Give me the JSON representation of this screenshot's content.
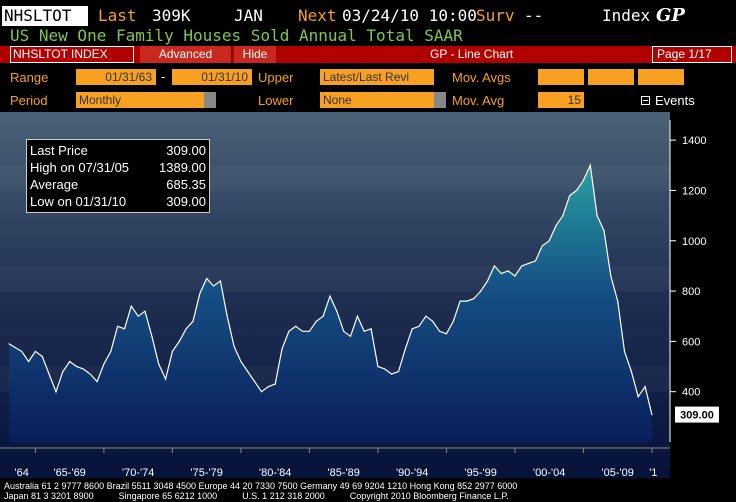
{
  "header": {
    "ticker": "NHSLTOT",
    "last_label": "Last",
    "last_value": "309K",
    "period": "JAN",
    "next_label": "Next",
    "next_value": "03/24/10 10:00",
    "surv_label": "Surv",
    "surv_value": "--",
    "index_label": "Index",
    "gp_label": "GP",
    "title": "US New One Family Houses Sold Annual Total SAAR"
  },
  "toolbar": {
    "security": "NHSLTOT INDEX",
    "advanced": "Advanced",
    "hide": "Hide",
    "chart_type": "GP - Line Chart",
    "page": "Page 1/17"
  },
  "controls": {
    "range_label": "Range",
    "range_start": "01/31/63",
    "range_dash": "-",
    "range_end": "01/31/10",
    "upper_label": "Upper",
    "upper_value": "Latest/Last Revi",
    "mov_avgs_label": "Mov. Avgs",
    "period_label": "Period",
    "period_value": "Monthly",
    "lower_label": "Lower",
    "lower_value": "None",
    "mov_avg_label": "Mov. Avg",
    "mov_avg_value": "15",
    "events_label": "Events"
  },
  "stats": {
    "last_price_label": "Last Price",
    "last_price_value": "309.00",
    "high_label": "High on 07/31/05",
    "high_value": "1389.00",
    "average_label": "Average",
    "average_value": "685.35",
    "low_label": "Low on 01/31/10",
    "low_value": "309.00"
  },
  "footer": {
    "line1": "Australia 61 2 9777 8600 Brazil 5511 3048 4500 Europe 44 20 7330 7500 Germany 49 69 9204 1210 Hong Kong 852 2977 6000",
    "line2": "Japan 81 3 3201 8900          Singapore 65 6212 1000          U.S. 1 212 318 2000          Copyright 2010 Bloomberg Finance L.P."
  },
  "colors": {
    "accent": "#f7a021",
    "title_green": "#7ec850",
    "header_red": "#b00000",
    "chart_top": "#4a6276",
    "chart_bottom": "#05123a",
    "area_top": "#1f8f98",
    "area_bottom": "#0a1e5a"
  },
  "chart_data": {
    "type": "area",
    "title": "US New One Family Houses Sold Annual Total SAAR",
    "xlabel": "",
    "ylabel": "",
    "ylim": [
      200,
      1480
    ],
    "yticks": [
      400,
      600,
      800,
      1000,
      1200,
      1400
    ],
    "xtick_labels": [
      "'64",
      "'65-'69",
      "'70-'74",
      "'75-'79",
      "'80-'84",
      "'85-'89",
      "'90-'94",
      "'95-'99",
      "'00-'04",
      "'05-'09",
      "'1"
    ],
    "last_value_label": "309.00",
    "grid": false,
    "x": [
      1963.08,
      1964.0,
      1964.5,
      1965.0,
      1965.5,
      1966.0,
      1966.5,
      1967.0,
      1967.5,
      1968.0,
      1968.5,
      1969.0,
      1969.5,
      1970.0,
      1970.5,
      1971.0,
      1971.5,
      1972.0,
      1972.5,
      1973.0,
      1973.5,
      1974.0,
      1974.5,
      1975.0,
      1975.5,
      1976.0,
      1976.5,
      1977.0,
      1977.5,
      1978.0,
      1978.5,
      1979.0,
      1979.5,
      1980.0,
      1980.5,
      1981.0,
      1981.5,
      1982.0,
      1982.5,
      1983.0,
      1983.5,
      1984.0,
      1984.5,
      1985.0,
      1985.5,
      1986.0,
      1986.5,
      1987.0,
      1987.5,
      1988.0,
      1988.5,
      1989.0,
      1989.5,
      1990.0,
      1990.5,
      1991.0,
      1991.5,
      1992.0,
      1992.5,
      1993.0,
      1993.5,
      1994.0,
      1994.5,
      1995.0,
      1995.5,
      1996.0,
      1996.5,
      1997.0,
      1997.5,
      1998.0,
      1998.5,
      1999.0,
      1999.5,
      2000.0,
      2000.5,
      2001.0,
      2001.5,
      2002.0,
      2002.5,
      2003.0,
      2003.5,
      2004.0,
      2004.5,
      2005.0,
      2005.5,
      2006.0,
      2006.5,
      2007.0,
      2007.5,
      2008.0,
      2008.5,
      2009.0,
      2009.5,
      2010.0
    ],
    "series": [
      {
        "values": [
          590,
          560,
          520,
          560,
          540,
          470,
          400,
          480,
          520,
          500,
          490,
          470,
          440,
          510,
          560,
          660,
          650,
          740,
          700,
          720,
          620,
          510,
          450,
          560,
          600,
          650,
          680,
          790,
          850,
          820,
          840,
          700,
          580,
          520,
          480,
          440,
          400,
          420,
          430,
          570,
          640,
          660,
          640,
          640,
          680,
          700,
          780,
          720,
          640,
          620,
          700,
          640,
          650,
          500,
          490,
          470,
          480,
          570,
          650,
          660,
          700,
          680,
          640,
          630,
          680,
          760,
          760,
          770,
          800,
          840,
          900,
          870,
          880,
          860,
          900,
          910,
          920,
          980,
          1000,
          1060,
          1100,
          1180,
          1200,
          1240,
          1300,
          1100,
          1040,
          860,
          760,
          560,
          480,
          380,
          420,
          309
        ]
      }
    ]
  }
}
